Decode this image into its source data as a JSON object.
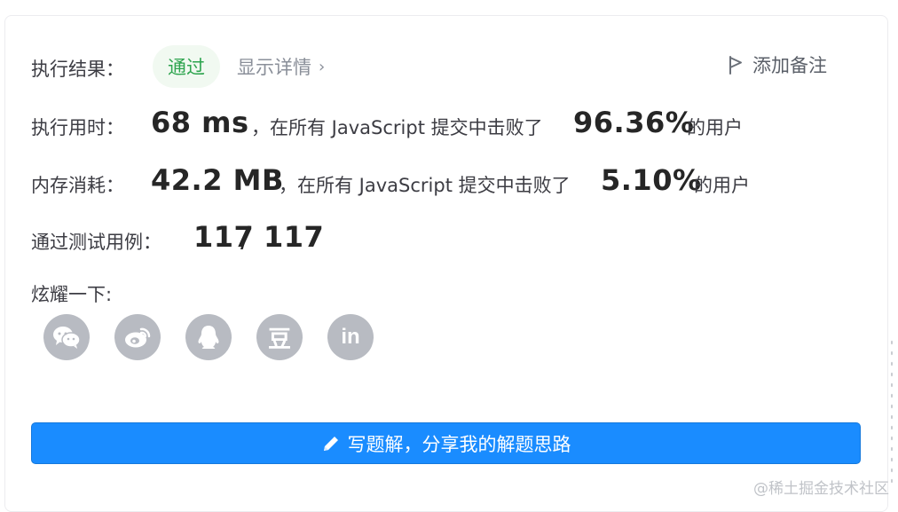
{
  "result": {
    "label": "执行结果：",
    "status": "通过",
    "details_link": "显示详情",
    "add_note": "添加备注"
  },
  "runtime": {
    "label": "执行用时：",
    "value": "68 ms",
    "text_before": "，在所有 JavaScript 提交中击败了",
    "percent": "96.36%",
    "text_after": "的用户"
  },
  "memory": {
    "label": "内存消耗：",
    "value": "42.2 MB",
    "text_before": "，在所有 JavaScript 提交中击败了",
    "percent": "5.10%",
    "text_after": "的用户"
  },
  "tests": {
    "label": "通过测试用例：",
    "passed": "117",
    "separator": "/",
    "total": "117"
  },
  "share": {
    "label": "炫耀一下:",
    "icons": [
      "wechat-icon",
      "weibo-icon",
      "qq-icon",
      "douban-icon",
      "linkedin-icon"
    ],
    "douban_glyph": "豆",
    "linkedin_glyph": "in",
    "icon_color": "#b8bbc2"
  },
  "write_solution": {
    "label": "写题解，分享我的解题思路",
    "color": "#1a8cff"
  },
  "watermark": "@稀土掘金技术社区",
  "colors": {
    "pass_green": "#2da44e",
    "badge_bg": "#f1f9f1"
  }
}
